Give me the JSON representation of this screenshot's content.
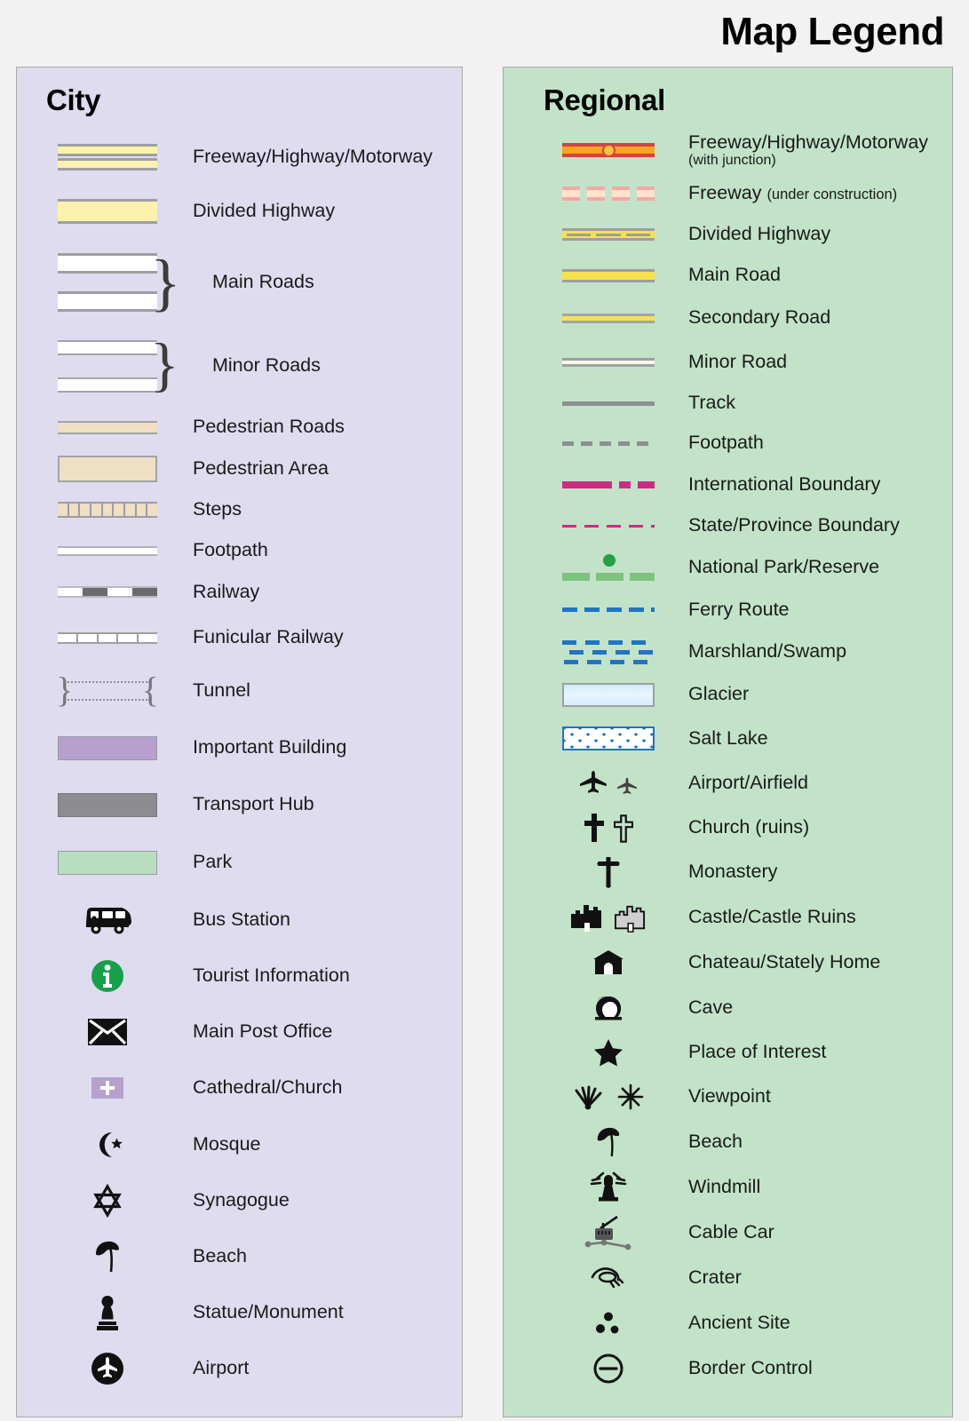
{
  "title": "Map Legend",
  "panels": {
    "city": {
      "heading": "City",
      "accent": "#dedcee",
      "items": [
        {
          "label": "Freeway/Highway/Motorway",
          "symbol": "city-freeway"
        },
        {
          "label": "Divided Highway",
          "symbol": "city-divided"
        },
        {
          "label": "Main Roads",
          "symbol": "city-main-roads-braced"
        },
        {
          "label": "Minor Roads",
          "symbol": "city-minor-roads-braced"
        },
        {
          "label": "Pedestrian Roads",
          "symbol": "city-pedestrian-road"
        },
        {
          "label": "Pedestrian Area",
          "symbol": "city-pedestrian-area"
        },
        {
          "label": "Steps",
          "symbol": "city-steps"
        },
        {
          "label": "Footpath",
          "symbol": "city-footpath"
        },
        {
          "label": "Railway",
          "symbol": "city-railway"
        },
        {
          "label": "Funicular Railway",
          "symbol": "city-funicular-railway"
        },
        {
          "label": "Tunnel",
          "symbol": "city-tunnel"
        },
        {
          "label": "Important Building",
          "symbol": "city-important-building"
        },
        {
          "label": "Transport Hub",
          "symbol": "city-transport-hub"
        },
        {
          "label": "Park",
          "symbol": "city-park"
        },
        {
          "label": "Bus Station",
          "symbol": "bus-icon"
        },
        {
          "label": "Tourist Information",
          "symbol": "information-icon"
        },
        {
          "label": "Main Post Office",
          "symbol": "envelope-icon"
        },
        {
          "label": "Cathedral/Church",
          "symbol": "church-chip-icon"
        },
        {
          "label": "Mosque",
          "symbol": "star-and-crescent-icon"
        },
        {
          "label": "Synagogue",
          "symbol": "star-of-david-icon"
        },
        {
          "label": "Beach",
          "symbol": "parasol-icon"
        },
        {
          "label": "Statue/Monument",
          "symbol": "statue-icon"
        },
        {
          "label": "Airport",
          "symbol": "airplane-circle-icon"
        }
      ]
    },
    "regional": {
      "heading": "Regional",
      "accent": "#c2e3c8",
      "items": [
        {
          "label": "Freeway/Highway/Motorway",
          "sublabel": "(with junction)",
          "symbol": "regional-freeway-junction"
        },
        {
          "label": "Freeway",
          "inline_sub": "(under construction)",
          "symbol": "regional-freeway-under-construction"
        },
        {
          "label": "Divided Highway",
          "symbol": "regional-divided-highway"
        },
        {
          "label": "Main Road",
          "symbol": "regional-main-road"
        },
        {
          "label": "Secondary Road",
          "symbol": "regional-secondary-road"
        },
        {
          "label": "Minor Road",
          "symbol": "regional-minor-road"
        },
        {
          "label": "Track",
          "symbol": "regional-track"
        },
        {
          "label": "Footpath",
          "symbol": "regional-footpath"
        },
        {
          "label": "International Boundary",
          "symbol": "regional-international-boundary"
        },
        {
          "label": "State/Province Boundary",
          "symbol": "regional-state-boundary"
        },
        {
          "label": "National Park/Reserve",
          "symbol": "regional-national-park"
        },
        {
          "label": "Ferry Route",
          "symbol": "regional-ferry-route"
        },
        {
          "label": "Marshland/Swamp",
          "symbol": "regional-marshland"
        },
        {
          "label": "Glacier",
          "symbol": "regional-glacier"
        },
        {
          "label": "Salt Lake",
          "symbol": "regional-salt-lake"
        },
        {
          "label": "Airport/Airfield",
          "symbol": "airplane-pair-icon"
        },
        {
          "label": "Church (ruins)",
          "symbol": "cross-pair-icon"
        },
        {
          "label": "Monastery",
          "symbol": "orthodox-cross-icon"
        },
        {
          "label": "Castle/Castle Ruins",
          "symbol": "castle-pair-icon"
        },
        {
          "label": "Chateau/Stately Home",
          "symbol": "chateau-icon"
        },
        {
          "label": "Cave",
          "symbol": "cave-icon"
        },
        {
          "label": "Place of Interest",
          "symbol": "star-icon"
        },
        {
          "label": "Viewpoint",
          "symbol": "viewpoint-pair-icon"
        },
        {
          "label": "Beach",
          "symbol": "parasol-icon"
        },
        {
          "label": "Windmill",
          "symbol": "windmill-icon"
        },
        {
          "label": "Cable Car",
          "symbol": "cable-car-icon"
        },
        {
          "label": "Crater",
          "symbol": "crater-icon"
        },
        {
          "label": "Ancient Site",
          "symbol": "ancient-site-icon"
        },
        {
          "label": "Border Control",
          "symbol": "border-control-icon"
        }
      ]
    }
  },
  "colors": {
    "city_panel_bg": "#dedcee",
    "regional_panel_bg": "#c2e3c8",
    "page_bg": "#f2f2f2",
    "road_yellow": "#faf2ad",
    "regional_road_yellow": "#f7e14e",
    "freeway_red": "#d1453f",
    "freeway_orange": "#f5a623",
    "pedestrian_tan": "#efdfc4",
    "important_building_purple": "#b5a0ce",
    "transport_hub_gray": "#8c8c91",
    "park_green": "#b7dfbd",
    "boundary_magenta": "#cf2a86",
    "water_blue": "#1f74c4",
    "national_park_green": "#7ec27f",
    "information_green": "#17a04a"
  }
}
